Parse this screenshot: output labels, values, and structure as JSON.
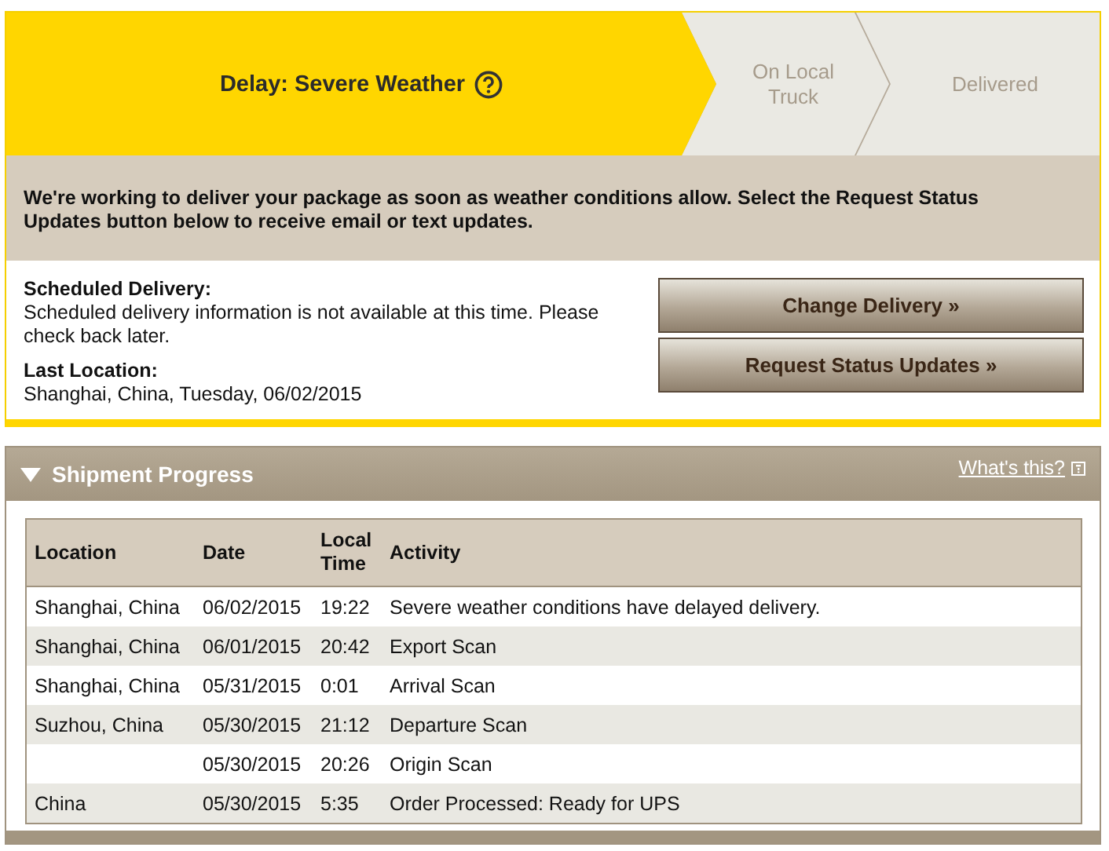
{
  "steps": [
    {
      "label": "Delay: Severe Weather",
      "selected": true
    },
    {
      "label": "On Local Truck",
      "selected": false
    },
    {
      "label": "Delivered",
      "selected": false
    }
  ],
  "message": "We're working to deliver your package as soon as weather conditions allow. Select the Request Status Updates button below to receive email or text updates.",
  "details": [
    {
      "label": "Scheduled Delivery:",
      "value": "Scheduled delivery information is not available at this time. Please check back later."
    },
    {
      "label": "Last Location:",
      "value": "Shanghai, China, Tuesday, 06/02/2015"
    }
  ],
  "buttons": [
    "Change Delivery »",
    "Request Status Updates »"
  ],
  "shipment_progress": {
    "title": "Shipment Progress",
    "expanded": true,
    "help_link": "What's this?",
    "table": {
      "columns": [
        "Location",
        "Date",
        "Local Time",
        "Activity"
      ],
      "rows": [
        [
          "Shanghai, China",
          "06/02/2015",
          "19:22",
          "Severe weather conditions have delayed delivery."
        ],
        [
          "Shanghai, China",
          "06/01/2015",
          "20:42",
          "Export Scan"
        ],
        [
          "Shanghai, China",
          "05/31/2015",
          "0:01",
          "Arrival Scan"
        ],
        [
          "Suzhou, China",
          "05/30/2015",
          "21:12",
          "Departure Scan"
        ],
        [
          "",
          "05/30/2015",
          "20:26",
          "Origin Scan"
        ],
        [
          "China",
          "05/30/2015",
          "5:35",
          "Order Processed: Ready for UPS"
        ]
      ]
    }
  }
}
